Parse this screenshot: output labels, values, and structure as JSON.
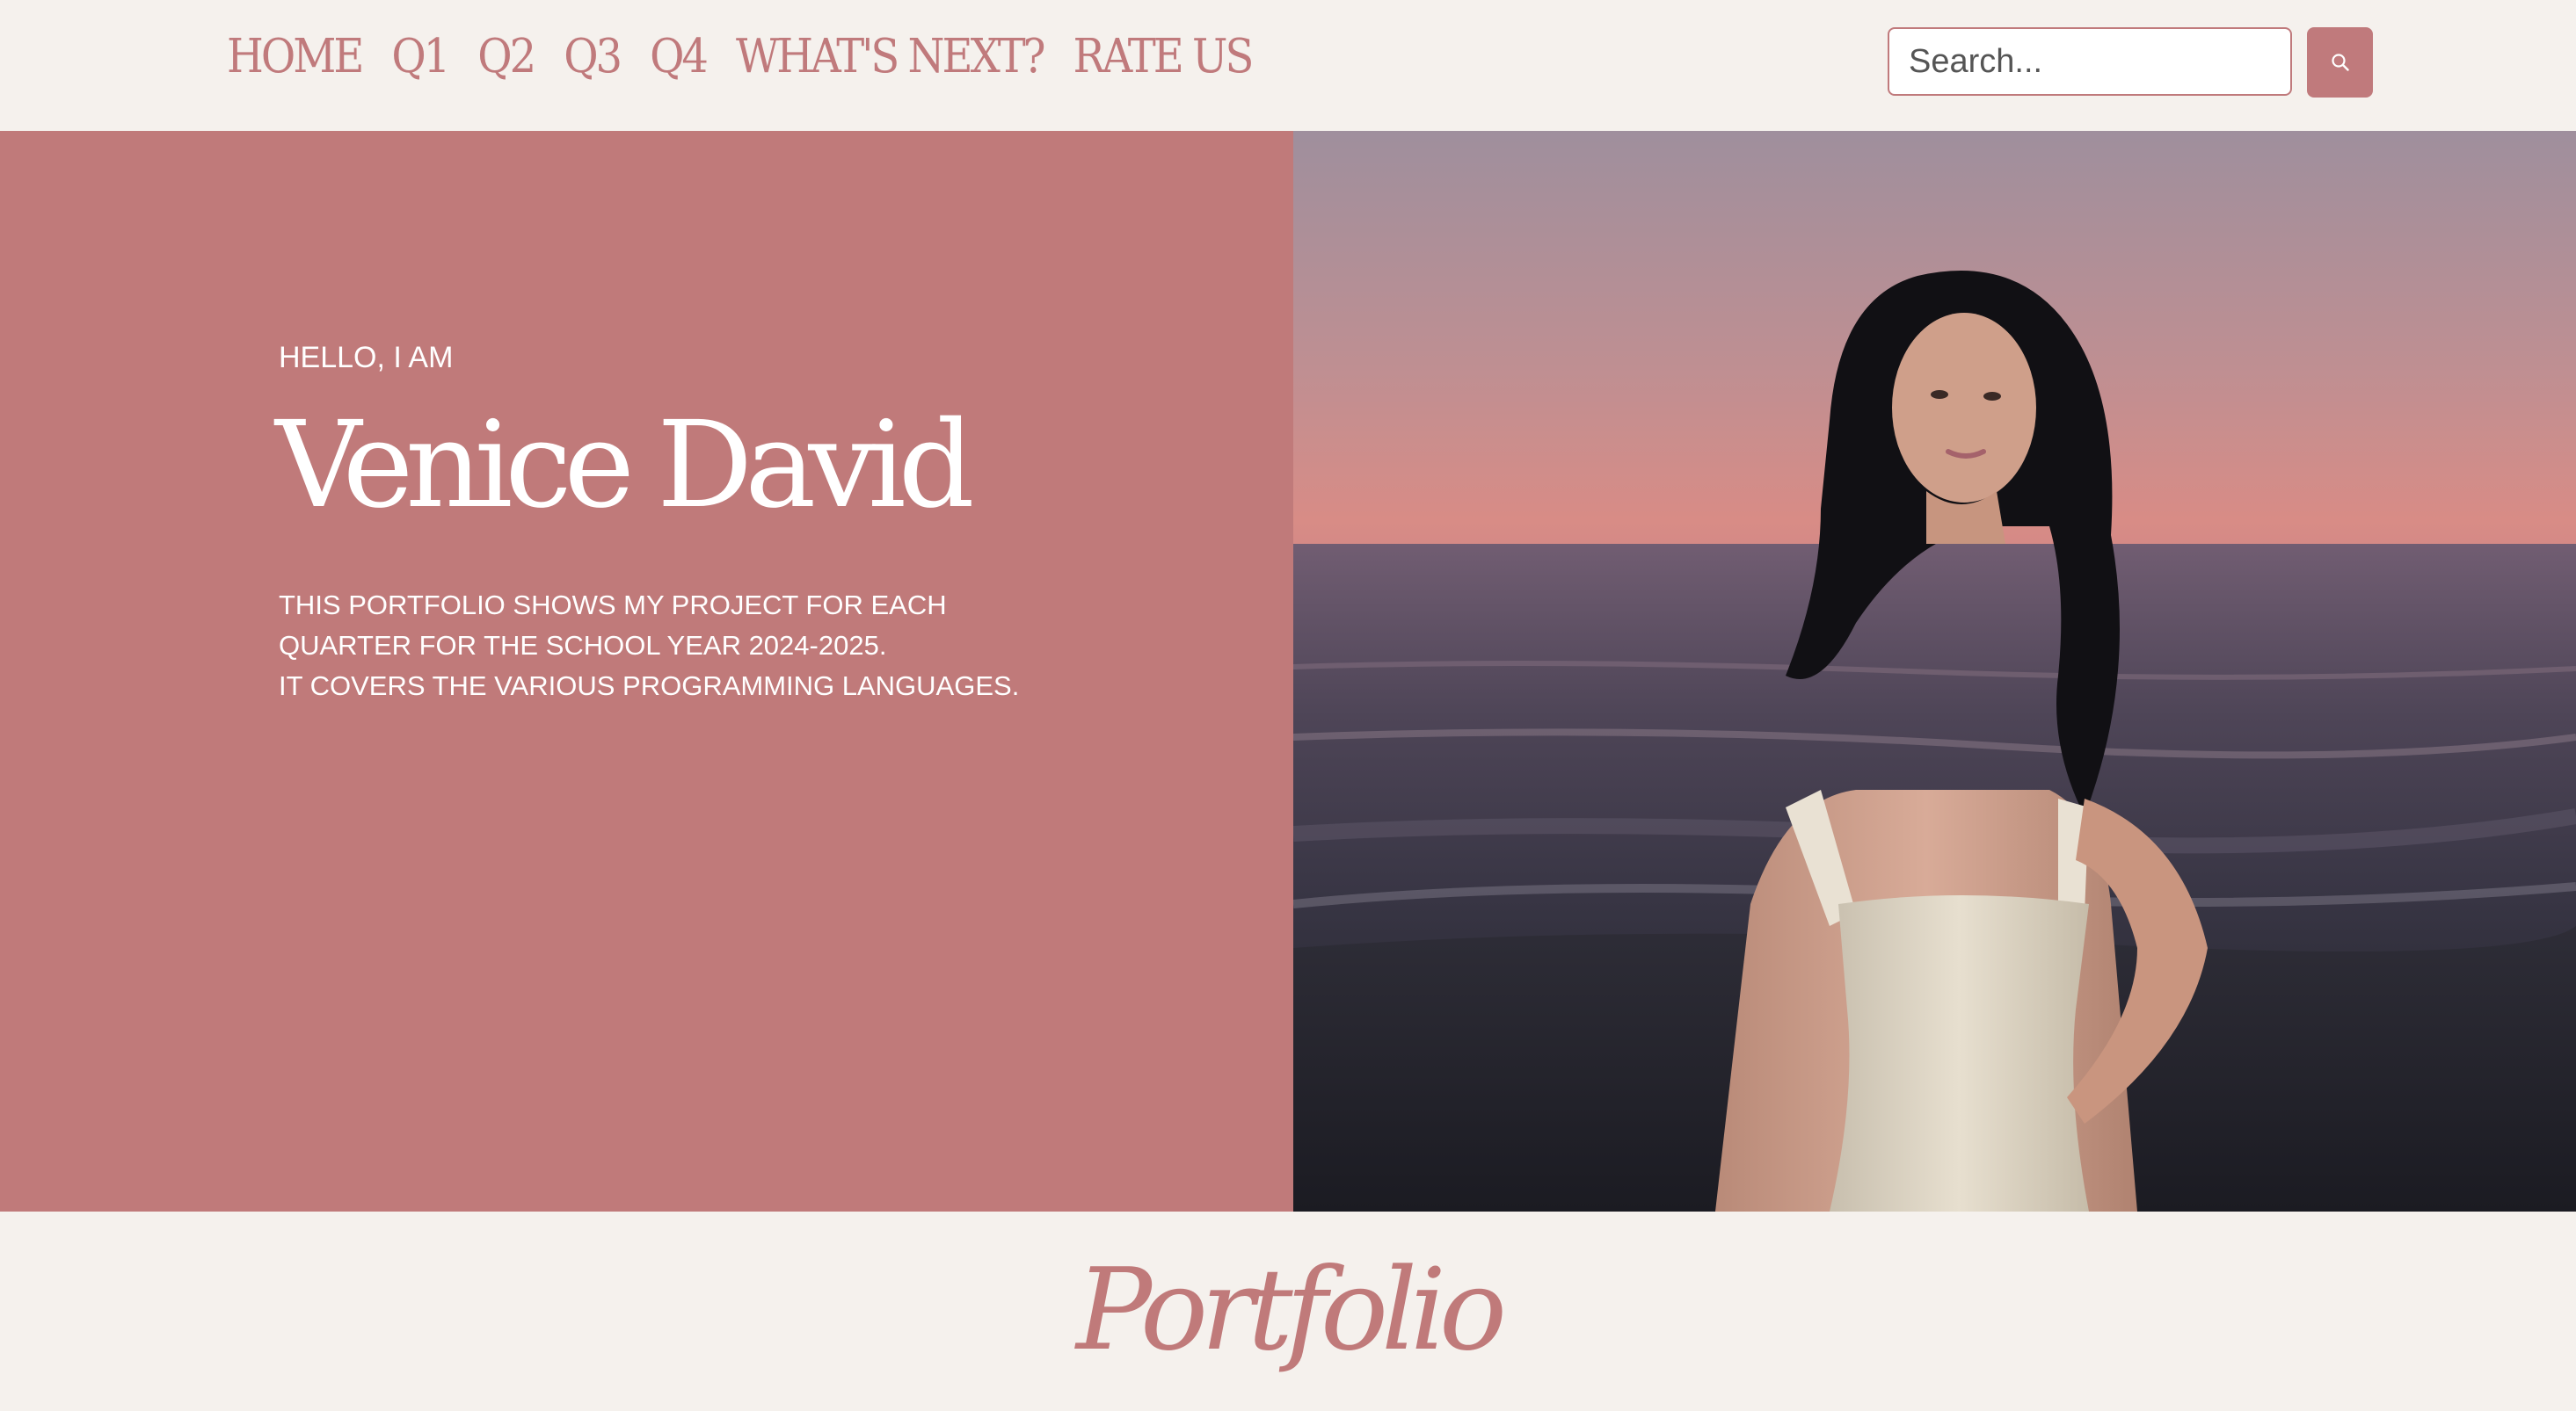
{
  "nav": {
    "items": [
      {
        "label": "HOME"
      },
      {
        "label": "Q1"
      },
      {
        "label": "Q2"
      },
      {
        "label": "Q3"
      },
      {
        "label": "Q4"
      },
      {
        "label": "WHAT'S NEXT?"
      },
      {
        "label": "RATE US"
      }
    ]
  },
  "search": {
    "placeholder": "Search...",
    "value": "",
    "icon": "search-icon"
  },
  "hero": {
    "greeting": "HELLO, I AM",
    "name": "Venice David",
    "description": [
      "THIS PORTFOLIO SHOWS MY PROJECT FOR EACH",
      "QUARTER FOR THE SCHOOL YEAR 2024-2025.",
      "IT COVERS THE VARIOUS PROGRAMMING LANGUAGES."
    ]
  },
  "section": {
    "title": "Portfolio"
  },
  "colors": {
    "accent": "#c07a7a",
    "background": "#f5f1ed",
    "text_on_accent": "#ffffff"
  }
}
